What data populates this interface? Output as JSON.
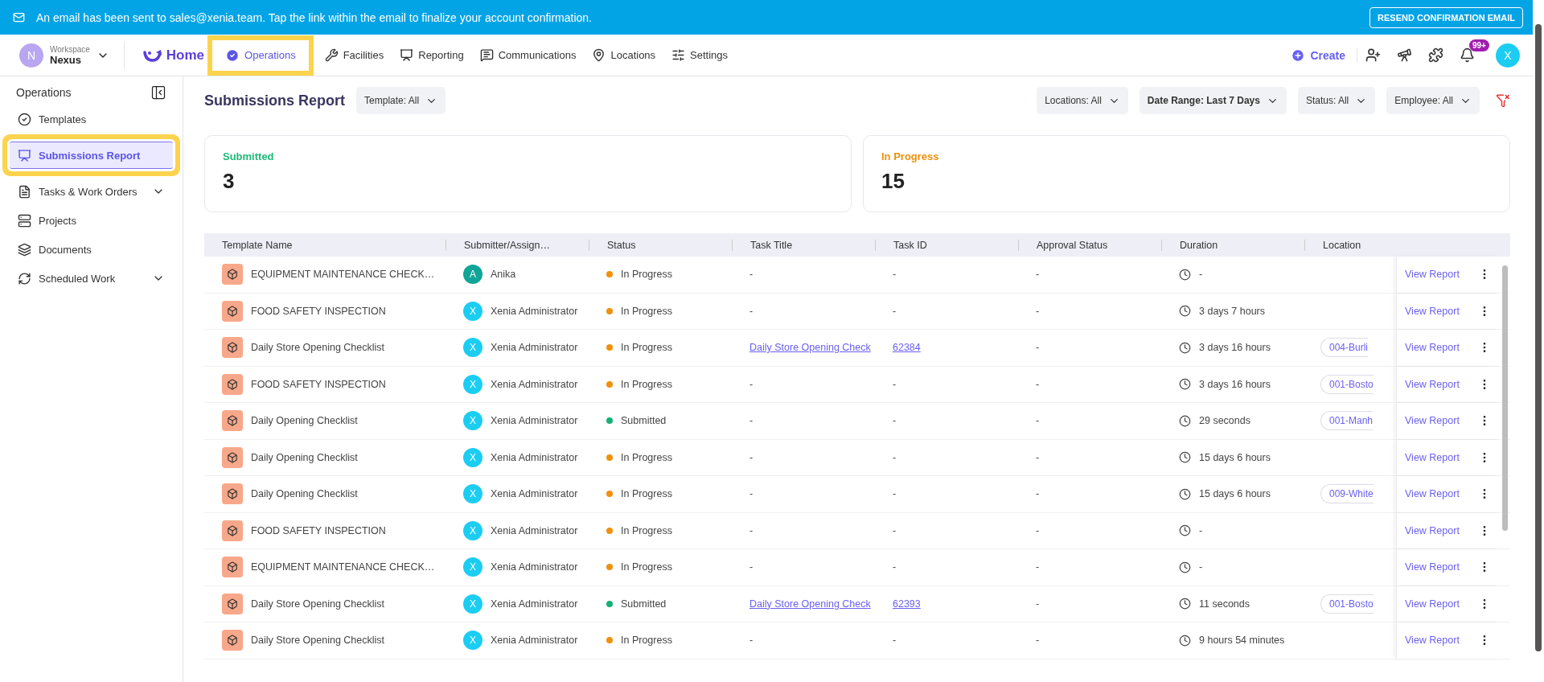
{
  "banner": {
    "message": "An email has been sent to sales@xenia.team. Tap the link within the email to finalize your account confirmation.",
    "button": "RESEND CONFIRMATION EMAIL"
  },
  "workspace": {
    "avatar": "N",
    "caption": "Workspace",
    "name": "Nexus"
  },
  "home": "Home",
  "nav": [
    {
      "label": "Operations",
      "selected": true,
      "highlighted": true
    },
    {
      "label": "Facilities",
      "selected": false,
      "highlighted": false
    },
    {
      "label": "Reporting",
      "selected": false,
      "highlighted": false
    },
    {
      "label": "Communications",
      "selected": false,
      "highlighted": false
    },
    {
      "label": "Locations",
      "selected": false,
      "highlighted": false
    },
    {
      "label": "Settings",
      "selected": false,
      "highlighted": false
    }
  ],
  "create": "Create",
  "notifications": "99+",
  "user_avatar": "X",
  "sidebar": {
    "title": "Operations",
    "items": [
      {
        "label": "Templates",
        "selected": false,
        "expandable": false,
        "highlighted": false
      },
      {
        "label": "Submissions Report",
        "selected": true,
        "expandable": false,
        "highlighted": true
      },
      {
        "label": "Tasks & Work Orders",
        "selected": false,
        "expandable": true,
        "highlighted": false
      },
      {
        "label": "Projects",
        "selected": false,
        "expandable": false,
        "highlighted": false
      },
      {
        "label": "Documents",
        "selected": false,
        "expandable": false,
        "highlighted": false
      },
      {
        "label": "Scheduled Work",
        "selected": false,
        "expandable": true,
        "highlighted": false
      }
    ]
  },
  "page_title": "Submissions Report",
  "template_filter": "Template: All",
  "filters": [
    {
      "label": "Locations: All",
      "bold": false
    },
    {
      "label": "Date Range: Last 7 Days",
      "bold": true
    },
    {
      "label": "Status: All",
      "bold": false
    },
    {
      "label": "Employee: All",
      "bold": false
    }
  ],
  "cards": [
    {
      "label": "Submitted",
      "value": "3",
      "color": "#1fb978"
    },
    {
      "label": "In Progress",
      "value": "15",
      "color": "#f0900c"
    }
  ],
  "table": {
    "columns": [
      "Template Name",
      "Submitter/Assign…",
      "Status",
      "Task Title",
      "Task ID",
      "Approval Status",
      "Duration",
      "Location"
    ],
    "rows": [
      {
        "template": "EQUIPMENT MAINTENANCE CHECK…",
        "avatar": {
          "letter": "A",
          "color": "#10a597"
        },
        "submitter": "Anika",
        "status": {
          "label": "In Progress",
          "color": "#f0900c"
        },
        "task_title": "-",
        "task_link": false,
        "task_id": "-",
        "approval": "-",
        "duration": "-",
        "location": null,
        "action": "View Report"
      },
      {
        "template": "FOOD SAFETY INSPECTION",
        "avatar": {
          "letter": "X",
          "color": "#1ccdf2"
        },
        "submitter": "Xenia Administrator",
        "status": {
          "label": "In Progress",
          "color": "#f0900c"
        },
        "task_title": "-",
        "task_link": false,
        "task_id": "-",
        "approval": "-",
        "duration": "3 days 7 hours",
        "location": null,
        "action": "View Report"
      },
      {
        "template": "Daily Store Opening Checklist",
        "avatar": {
          "letter": "X",
          "color": "#1ccdf2"
        },
        "submitter": "Xenia Administrator",
        "status": {
          "label": "In Progress",
          "color": "#f0900c"
        },
        "task_title": "Daily Store Opening Check",
        "task_link": true,
        "task_id": "62384",
        "approval": "-",
        "duration": "3 days 16 hours",
        "location": "004-Burli",
        "action": "View Report"
      },
      {
        "template": "FOOD SAFETY INSPECTION",
        "avatar": {
          "letter": "X",
          "color": "#1ccdf2"
        },
        "submitter": "Xenia Administrator",
        "status": {
          "label": "In Progress",
          "color": "#f0900c"
        },
        "task_title": "-",
        "task_link": false,
        "task_id": "-",
        "approval": "-",
        "duration": "3 days 16 hours",
        "location": "001-Bosto",
        "action": "View Report"
      },
      {
        "template": "Daily Opening Checklist",
        "avatar": {
          "letter": "X",
          "color": "#1ccdf2"
        },
        "submitter": "Xenia Administrator",
        "status": {
          "label": "Submitted",
          "color": "#16b075"
        },
        "task_title": "-",
        "task_link": false,
        "task_id": "-",
        "approval": "-",
        "duration": "29 seconds",
        "location": "001-Manh",
        "action": "View Report"
      },
      {
        "template": "Daily Opening Checklist",
        "avatar": {
          "letter": "X",
          "color": "#1ccdf2"
        },
        "submitter": "Xenia Administrator",
        "status": {
          "label": "In Progress",
          "color": "#f0900c"
        },
        "task_title": "-",
        "task_link": false,
        "task_id": "-",
        "approval": "-",
        "duration": "15 days 6 hours",
        "location": null,
        "action": "View Report"
      },
      {
        "template": "Daily Opening Checklist",
        "avatar": {
          "letter": "X",
          "color": "#1ccdf2"
        },
        "submitter": "Xenia Administrator",
        "status": {
          "label": "In Progress",
          "color": "#f0900c"
        },
        "task_title": "-",
        "task_link": false,
        "task_id": "-",
        "approval": "-",
        "duration": "15 days 6 hours",
        "location": "009-White",
        "action": "View Report"
      },
      {
        "template": "FOOD SAFETY INSPECTION",
        "avatar": {
          "letter": "X",
          "color": "#1ccdf2"
        },
        "submitter": "Xenia Administrator",
        "status": {
          "label": "In Progress",
          "color": "#f0900c"
        },
        "task_title": "-",
        "task_link": false,
        "task_id": "-",
        "approval": "-",
        "duration": "-",
        "location": null,
        "action": "View Report"
      },
      {
        "template": "EQUIPMENT MAINTENANCE CHECK…",
        "avatar": {
          "letter": "X",
          "color": "#1ccdf2"
        },
        "submitter": "Xenia Administrator",
        "status": {
          "label": "In Progress",
          "color": "#f0900c"
        },
        "task_title": "-",
        "task_link": false,
        "task_id": "-",
        "approval": "-",
        "duration": "-",
        "location": null,
        "action": "View Report"
      },
      {
        "template": "Daily Store Opening Checklist",
        "avatar": {
          "letter": "X",
          "color": "#1ccdf2"
        },
        "submitter": "Xenia Administrator",
        "status": {
          "label": "Submitted",
          "color": "#16b075"
        },
        "task_title": "Daily Store Opening Check",
        "task_link": true,
        "task_id": "62393",
        "approval": "-",
        "duration": "11 seconds",
        "location": "001-Bosto",
        "action": "View Report"
      },
      {
        "template": "Daily Store Opening Checklist",
        "avatar": {
          "letter": "X",
          "color": "#1ccdf2"
        },
        "submitter": "Xenia Administrator",
        "status": {
          "label": "In Progress",
          "color": "#f0900c"
        },
        "task_title": "-",
        "task_link": false,
        "task_id": "-",
        "approval": "-",
        "duration": "9 hours 54 minutes",
        "location": null,
        "action": "View Report"
      }
    ]
  }
}
